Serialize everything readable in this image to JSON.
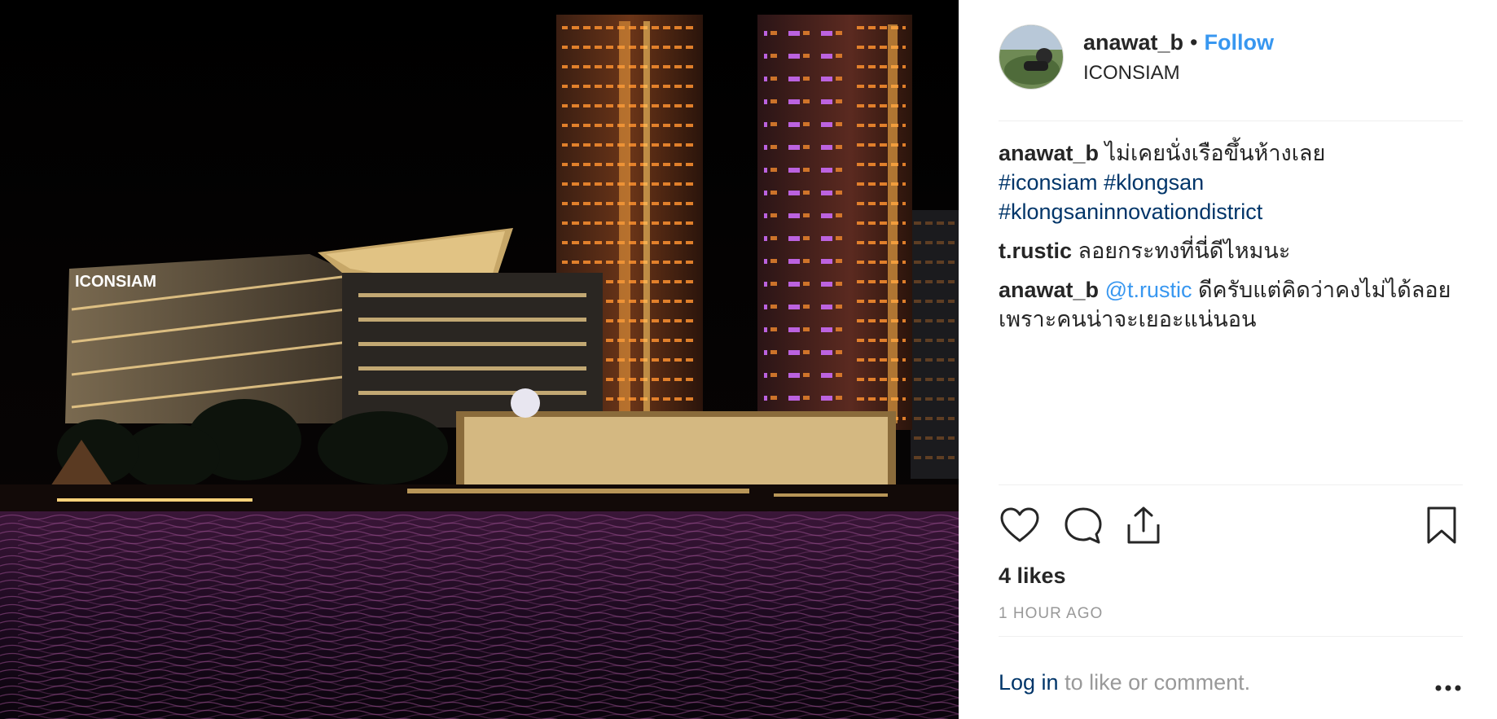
{
  "photo": {
    "description_icon": "night-cityscape-photo",
    "sign_text": "ICONSIAM",
    "colors": {
      "sky": "#050505",
      "tower_orange": "#e9822a",
      "tower_purple": "#b25ad6",
      "water": "#2a0f2e"
    }
  },
  "header": {
    "username": "anawat_b",
    "separator": "•",
    "follow_label": "Follow",
    "location": "ICONSIAM"
  },
  "comments": [
    {
      "user": "anawat_b",
      "text": "ไม่เคยนั่งเรือขึ้นห้างเลย",
      "tags": [
        "#iconsiam",
        "#klongsan",
        "#klongsaninnovationdistrict"
      ]
    },
    {
      "user": "t.rustic",
      "text": "ลอยกระทงที่นี่ดีไหมนะ"
    },
    {
      "user": "anawat_b",
      "mention": "@t.rustic",
      "text": "ดีครับแต่คิดว่าคงไม่ได้ลอยเพราะคนน่าจะเยอะแน่นอน"
    }
  ],
  "actions": {
    "icons": [
      "heart-icon",
      "comment-icon",
      "share-icon",
      "bookmark-icon"
    ]
  },
  "likes": "4 likes",
  "time_ago": "1 HOUR AGO",
  "footer": {
    "login_label": "Log in",
    "rest_label": "to like or comment.",
    "more_icon": "more-options-icon"
  },
  "colors": {
    "link_blue": "#3897f0",
    "hashtag_blue": "#003569",
    "muted_gray": "#999999",
    "text": "#262626"
  }
}
